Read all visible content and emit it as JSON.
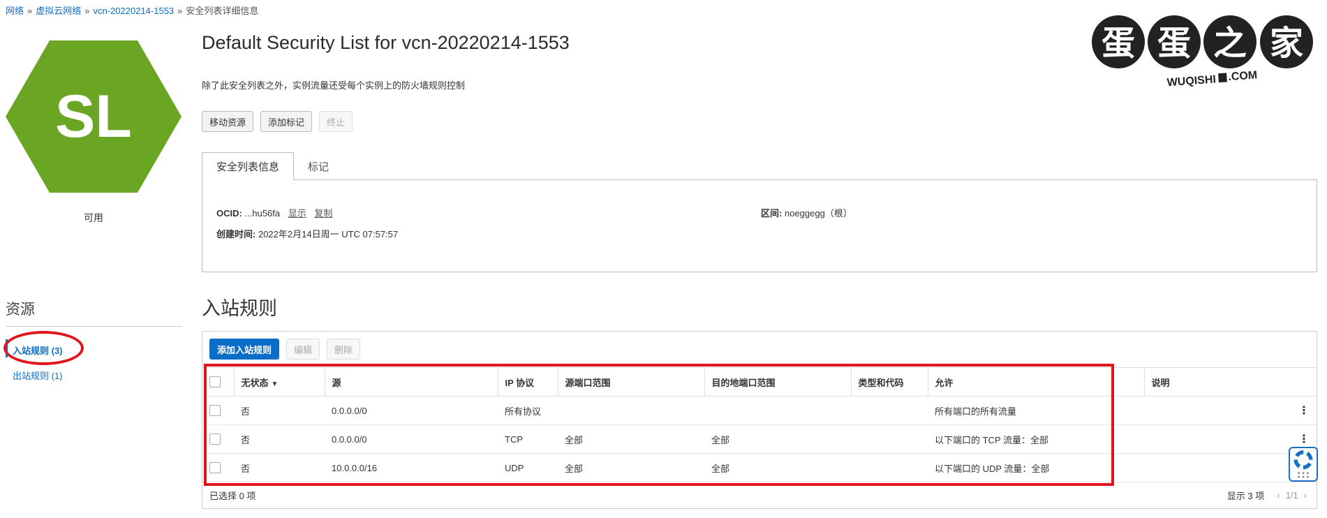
{
  "breadcrumb": {
    "items": [
      "网络",
      "虚拟云网络",
      "vcn-20220214-1553"
    ],
    "current": "安全列表详细信息"
  },
  "badge": {
    "initials": "SL",
    "status": "可用",
    "color": "#6aa524"
  },
  "header": {
    "title": "Default Security List for vcn-20220214-1553",
    "subtitle": "除了此安全列表之外，实例流量还受每个实例上的防火墙规则控制"
  },
  "actions": {
    "move": "移动资源",
    "add_tag": "添加标记",
    "terminate": "终止"
  },
  "tabs": [
    "安全列表信息",
    "标记"
  ],
  "info": {
    "ocid_label": "OCID:",
    "ocid_value": "...hu56fa",
    "show": "显示",
    "copy": "复制",
    "created_label": "创建时间:",
    "created_value": "2022年2月14日周一 UTC 07:57:57",
    "compartment_label": "区间:",
    "compartment_value": "noeggegg（根）"
  },
  "logo": {
    "text": "蛋蛋之家",
    "subtext": "WUQISHI",
    "subtext2": ".COM"
  },
  "resources": {
    "title": "资源",
    "items": [
      "入站规则 (3)",
      "出站规则 (1)"
    ]
  },
  "ingress": {
    "title": "入站规则",
    "add_button": "添加入站规则",
    "edit_button": "编辑",
    "delete_button": "删除",
    "columns": [
      "无状态",
      "源",
      "IP 协议",
      "源端口范围",
      "目的地端口范围",
      "类型和代码",
      "允许",
      "说明"
    ],
    "rows": [
      [
        "否",
        "0.0.0.0/0",
        "所有协议",
        "",
        "",
        "",
        "所有端口的所有流量",
        ""
      ],
      [
        "否",
        "0.0.0.0/0",
        "TCP",
        "全部",
        "全部",
        "",
        "以下端口的 TCP 流量：全部",
        ""
      ],
      [
        "否",
        "10.0.0.0/16",
        "UDP",
        "全部",
        "全部",
        "",
        "以下端口的 UDP 流量：全部",
        ""
      ]
    ],
    "selected": "已选择 0 项",
    "showing": "显示 3 项",
    "page": "1/1"
  }
}
